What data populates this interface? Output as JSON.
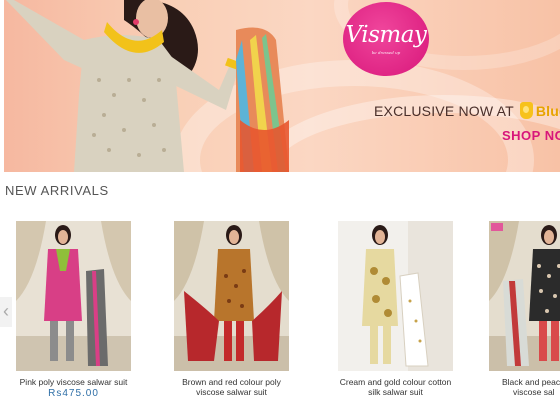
{
  "banner": {
    "logo_text": "Vismay",
    "logo_tagline": "be dressed up",
    "exclusive_text": "EXCLUSIVE NOW AT",
    "partner_brand": "Blueli",
    "cta": "SHOP NO"
  },
  "section": {
    "title": "NEW ARRIVALS"
  },
  "carousel": {
    "prev_arrow": "‹",
    "products": [
      {
        "name_line1": "Pink poly viscose salwar suit",
        "name_line2": "",
        "price": "Rs475.00"
      },
      {
        "name_line1": "Brown and red colour poly",
        "name_line2": "viscose salwar suit",
        "price": ""
      },
      {
        "name_line1": "Cream and gold colour cotton",
        "name_line2": "silk salwar suit",
        "price": ""
      },
      {
        "name_line1": "Black and peac",
        "name_line2": "viscose sal",
        "price": ""
      }
    ]
  },
  "colors": {
    "brand_pink": "#d8167a",
    "price_blue": "#2f6fa7",
    "partner_yellow": "#f7c21b"
  }
}
